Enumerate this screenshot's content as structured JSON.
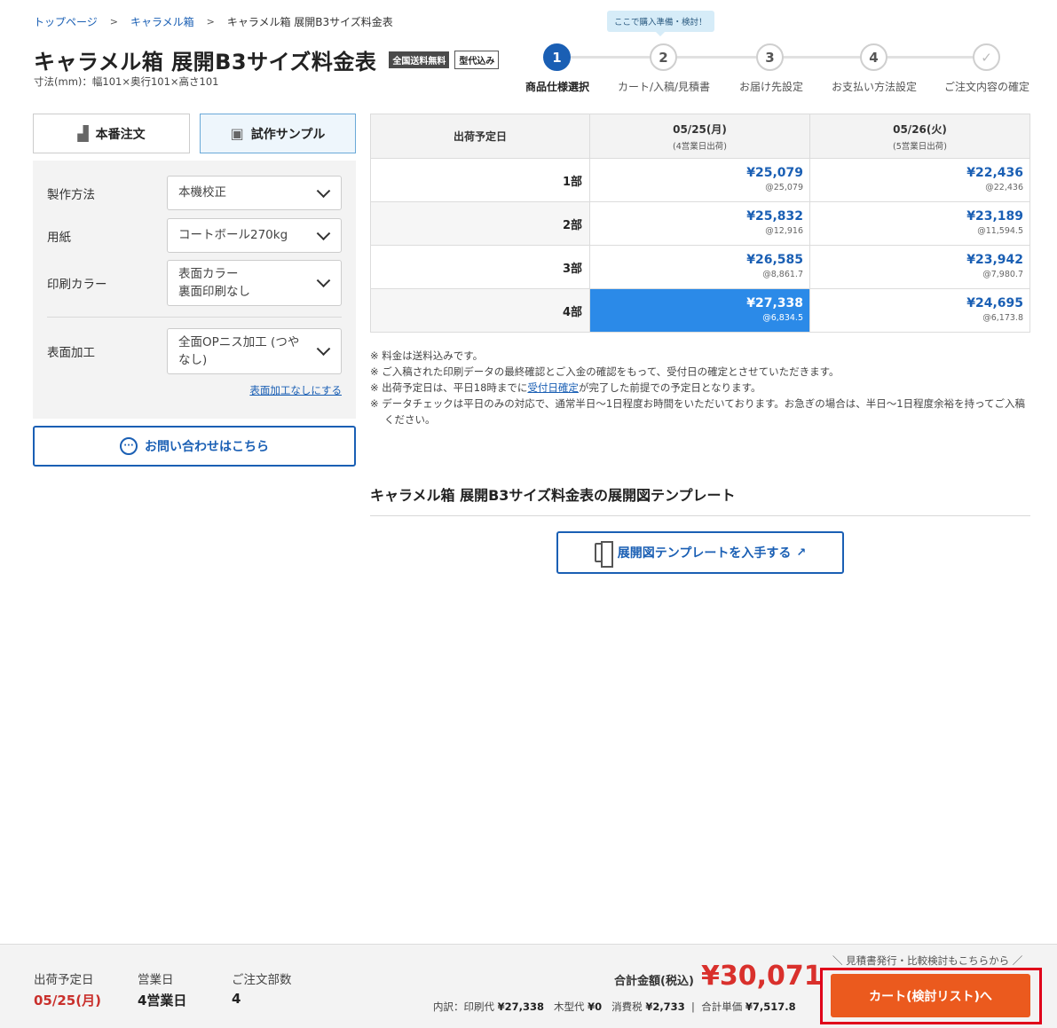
{
  "breadcrumb": {
    "items": [
      "トップページ",
      "キャラメル箱"
    ],
    "current": "キャラメル箱 展開B3サイズ料金表"
  },
  "product": {
    "title": "キャラメル箱 展開B3サイズ料金表",
    "badges": [
      "全国送料無料",
      "型代込み"
    ],
    "dimensions": "寸法(mm)：幅101×奥行101×高さ101"
  },
  "steps": {
    "tooltip": "ここで購入準備・検討！",
    "items": [
      {
        "num": "1",
        "label": "商品仕様選択",
        "active": true
      },
      {
        "num": "2",
        "label": "カート/入稿/見積書",
        "active": false
      },
      {
        "num": "3",
        "label": "お届け先設定",
        "active": false
      },
      {
        "num": "4",
        "label": "お支払い方法設定",
        "active": false
      },
      {
        "num": "✓",
        "label": "ご注文内容の確定",
        "active": false
      }
    ]
  },
  "order_tabs": {
    "production": "本番注文",
    "sample": "試作サンプル",
    "selected": "sample"
  },
  "options": [
    {
      "label": "製作方法",
      "value": "本機校正"
    },
    {
      "label": "用紙",
      "value": "コートボール270kg"
    },
    {
      "label": "印刷カラー",
      "value_line1": "表面カラー",
      "value_line2": "裏面印刷なし"
    },
    {
      "label": "表面加工",
      "value_line1": "全面OPニス加工 (つや",
      "value_line2": "なし)"
    }
  ],
  "remove_finish_link": "表面加工なしにする",
  "contact_button": "お問い合わせはこちら",
  "price_table": {
    "header_label": "出荷予定日",
    "columns": [
      {
        "date": "05/25(月)",
        "sub": "(4営業日出荷)"
      },
      {
        "date": "05/26(火)",
        "sub": "(5営業日出荷)"
      }
    ],
    "rows": [
      {
        "qty": "1部",
        "cells": [
          {
            "price": "¥25,079",
            "unit": "@25,079"
          },
          {
            "price": "¥22,436",
            "unit": "@22,436"
          }
        ]
      },
      {
        "qty": "2部",
        "cells": [
          {
            "price": "¥25,832",
            "unit": "@12,916"
          },
          {
            "price": "¥23,189",
            "unit": "@11,594.5"
          }
        ]
      },
      {
        "qty": "3部",
        "cells": [
          {
            "price": "¥26,585",
            "unit": "@8,861.7"
          },
          {
            "price": "¥23,942",
            "unit": "@7,980.7"
          }
        ]
      },
      {
        "qty": "4部",
        "cells": [
          {
            "price": "¥27,338",
            "unit": "@6,834.5"
          },
          {
            "price": "¥24,695",
            "unit": "@6,173.8"
          }
        ]
      }
    ],
    "selected": {
      "row": 3,
      "col": 0
    }
  },
  "notes": [
    "※ 料金は送料込みです。",
    "※ ご入稿された印刷データの最終確認とご入金の確認をもって、受付日の確定とさせていただきます。",
    {
      "pre": "※ 出荷予定日は、平日18時までに",
      "link": "受付日確定",
      "post": "が完了した前提での予定日となります。"
    },
    "※ データチェックは平日のみの対応で、通常半日〜1日程度お時間をいただいております。お急ぎの場合は、半日〜1日程度余裕を持ってご入稿ください。"
  ],
  "template_section": {
    "title": "キャラメル箱 展開B3サイズ料金表の展開図テンプレート",
    "button": "展開図テンプレートを入手する"
  },
  "footer": {
    "ship_label": "出荷予定日",
    "ship_value": "05/25(月)",
    "days_label": "営業日",
    "days_value": "4営業日",
    "qty_label": "ご注文部数",
    "qty_value": "4",
    "total_label": "合計金額(税込)",
    "total_value": "¥30,071",
    "breakdown": {
      "prefix": "内訳：印刷代",
      "print": "¥27,338",
      "die_label": "木型代",
      "die": "¥0",
      "tax_label": "消費税",
      "tax": "¥2,733",
      "unit_label": "合計単価",
      "unit": "¥7,517.8"
    },
    "hint": "＼ 見積書発行・比較検討もこちらから ／",
    "cart_button": "カート(検討リスト)へ"
  },
  "colors": {
    "accent": "#1a5fb4",
    "selected_cell": "#2b8ae8",
    "total": "#d9302c",
    "cart_button": "#eb5a1e",
    "highlight_frame": "#e0001a"
  }
}
